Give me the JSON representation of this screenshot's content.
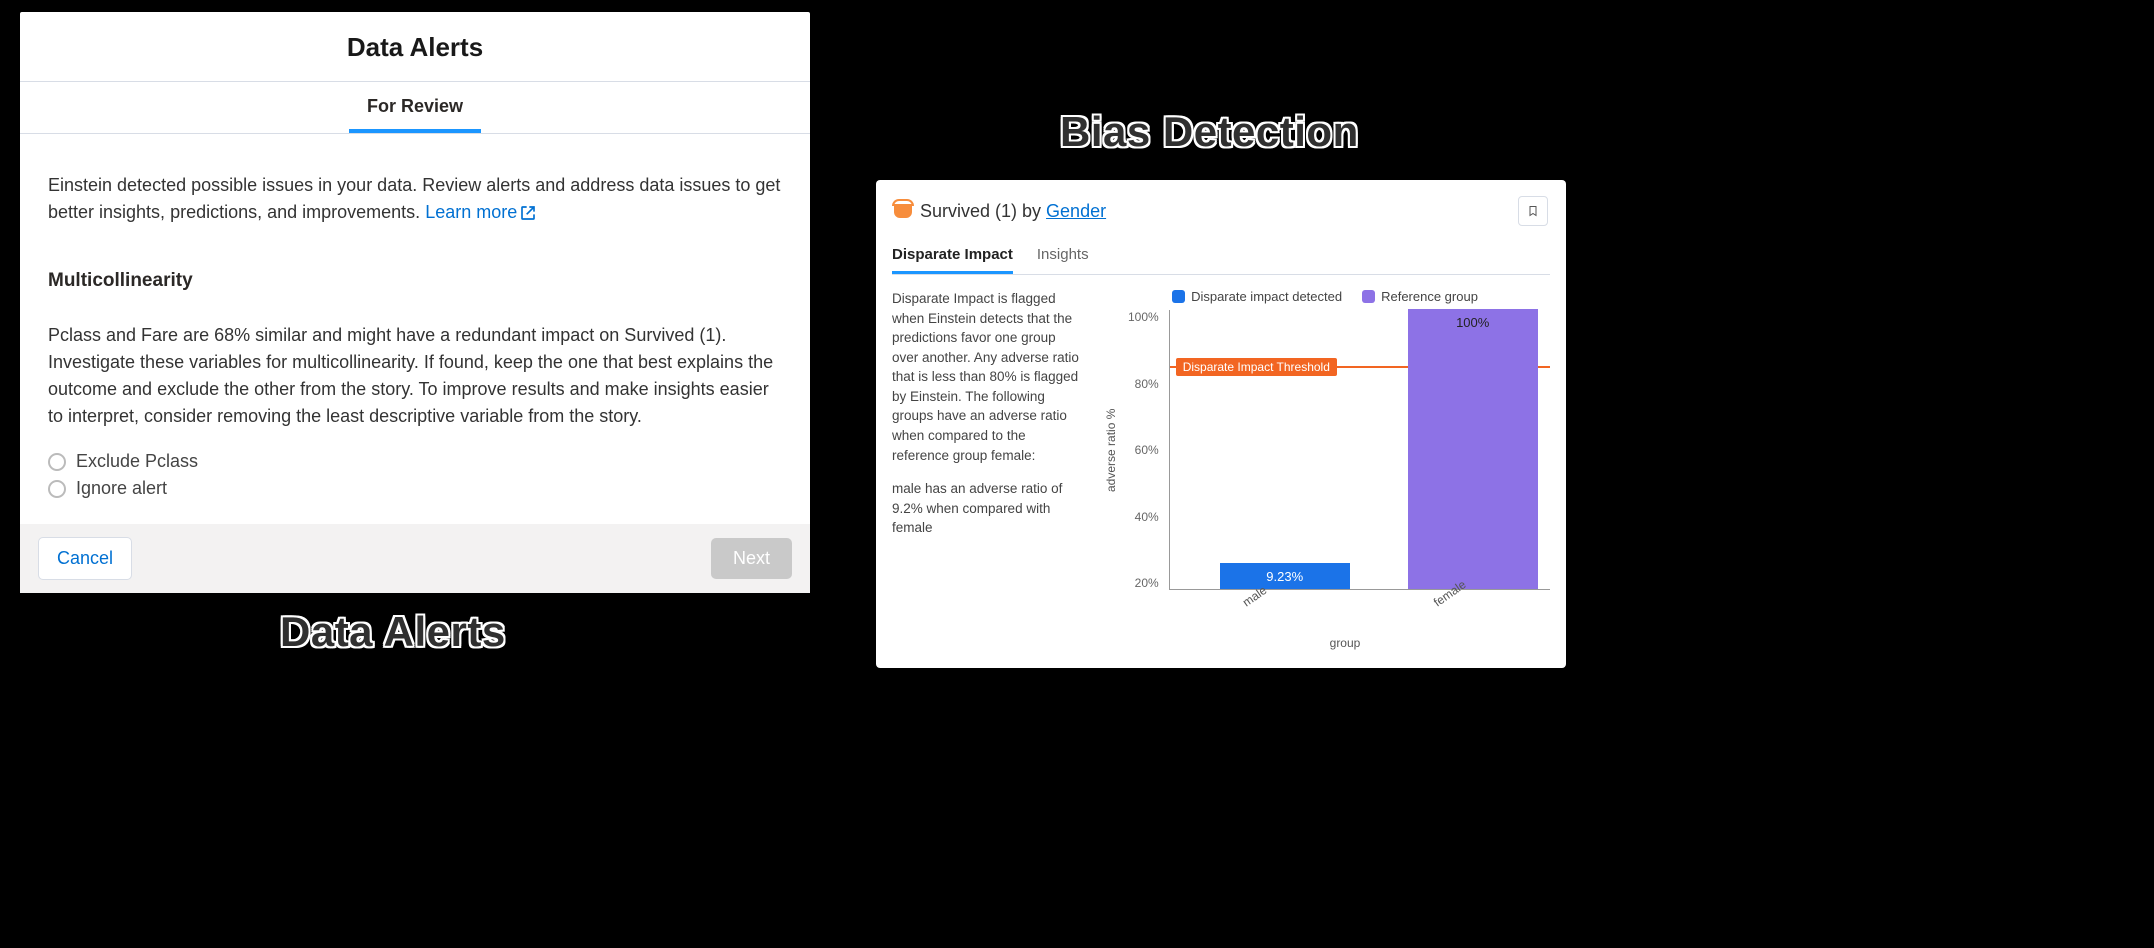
{
  "captions": {
    "left": "Data Alerts",
    "right": "Bias Detection"
  },
  "data_alerts": {
    "title": "Data Alerts",
    "tab": "For Review",
    "intro": "Einstein detected possible issues in your data. Review alerts and address data issues to get better insights, predictions, and improvements. ",
    "learn_more": "Learn more",
    "section_title": "Multicollinearity",
    "description": "Pclass and Fare are 68% similar and might have a redundant impact on Survived (1). Investigate these variables for multicollinearity. If found, keep the one that best explains the outcome and exclude the other from the story. To improve results and make insights easier to interpret, consider removing the least descriptive variable from the story.",
    "radio_exclude": "Exclude Pclass",
    "radio_ignore": "Ignore alert",
    "cancel": "Cancel",
    "next": "Next"
  },
  "bias": {
    "title_prefix": "Survived (1) by ",
    "title_link": "Gender",
    "tab_disparate": "Disparate Impact",
    "tab_insights": "Insights",
    "para1": "Disparate Impact is flagged when Einstein detects that the predictions favor one group over another. Any adverse ratio that is less than 80% is flagged by Einstein. The following groups have an adverse ratio when compared to the reference group female:",
    "para2": "male has an adverse ratio of 9.2% when compared with female",
    "legend_detected": "Disparate impact detected",
    "legend_reference": "Reference group",
    "y_ticks": [
      "100%",
      "80%",
      "60%",
      "40%",
      "20%"
    ],
    "y_label": "adverse ratio %",
    "x_label": "group",
    "threshold_label": "Disparate Impact Threshold",
    "bar_male_label": "9.23%",
    "bar_female_label": "100%",
    "x_tick_male": "male",
    "x_tick_female": "female"
  },
  "chart_data": {
    "type": "bar",
    "title": "Survived (1) by Gender — Disparate Impact",
    "xlabel": "group",
    "ylabel": "adverse ratio %",
    "ylim": [
      0,
      100
    ],
    "categories": [
      "male",
      "female"
    ],
    "series": [
      {
        "name": "Disparate impact detected",
        "color": "#1b73e8",
        "values": [
          9.23,
          null
        ]
      },
      {
        "name": "Reference group",
        "color": "#8d72e6",
        "values": [
          null,
          100
        ]
      }
    ],
    "threshold": {
      "label": "Disparate Impact Threshold",
      "value": 80
    },
    "y_ticks": [
      20,
      40,
      60,
      80,
      100
    ]
  }
}
